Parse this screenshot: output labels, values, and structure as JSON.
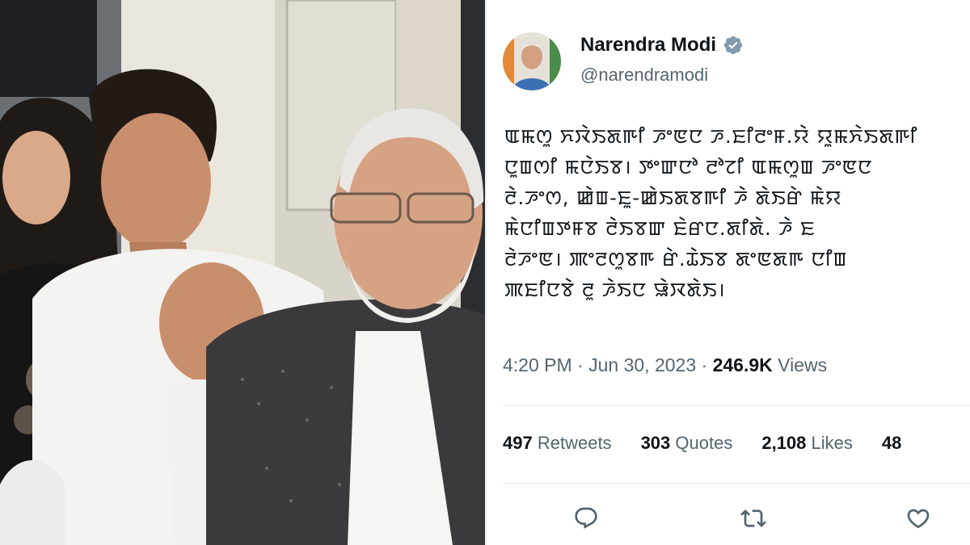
{
  "tweet": {
    "author": {
      "display_name": "Narendra Modi",
      "handle": "@narendramodi",
      "verified": true
    },
    "body_lines": [
      "ꯑꯃꯁꯨ ꯈꯋꯥꯏꯗꯒꯤ ꯍꯦꯟꯅ ꯍ.ꯐꯤꯂꯦꯝ.ꯌꯥ ꯌꯨꯃꯈꯥꯏꯗꯒꯤ",
      "ꯅꯨꯡꯁꯤ ꯃꯅꯥꯏꯕ। ꯇꯦꯛꯅꯣ ꯂꯣꯖꯤ ꯑꯃꯁꯨꯡ ꯍꯦꯟꯅ",
      "ꯂꯥ.ꯍꯦꯁ, ꯀꯥꯡ-ꯐꯨ-ꯀꯥꯏꯗꯕꯒꯤ ꯍꯥ ꯗꯥꯏꯔꯥ ꯃꯥꯌ",
      "ꯃꯥꯅꯤꯡꯇꯝꯕ ꯂꯥꯏꯕꯛ ꯐꯥꯔꯅ.ꯗꯤꯗꯥ. ꯍꯥ ꯐ",
      "ꯂꯥꯍꯦꯟ। ꯄꯦꯂꯁꯨꯕꯒ ꯔꯥ.ꯊꯥꯏꯕ ꯗꯦꯟꯗꯒ ꯅꯤꯡ",
      "ꯄꯐꯤꯅꯕꯥ ꯂꯨ ꯍꯥꯏꯅ ꯎꯥꯋꯗꯥꯏ।"
    ],
    "time": "4:20 PM",
    "date": "Jun 30, 2023",
    "views_count": "246.9K",
    "views_label": "Views",
    "stats": {
      "retweets_count": "497",
      "retweets_label": "Retweets",
      "quotes_count": "303",
      "quotes_label": "Quotes",
      "likes_count": "2,108",
      "likes_label": "Likes",
      "bookmarks_count": "48"
    },
    "icons": {
      "reply": "reply-icon",
      "retweet": "retweet-icon",
      "like": "like-icon",
      "verified": "verified-badge-icon"
    },
    "colors": {
      "text_primary": "#0f1419",
      "text_secondary": "#536471",
      "verified_badge": "#829aab",
      "divider": "#e6ecf0"
    }
  }
}
